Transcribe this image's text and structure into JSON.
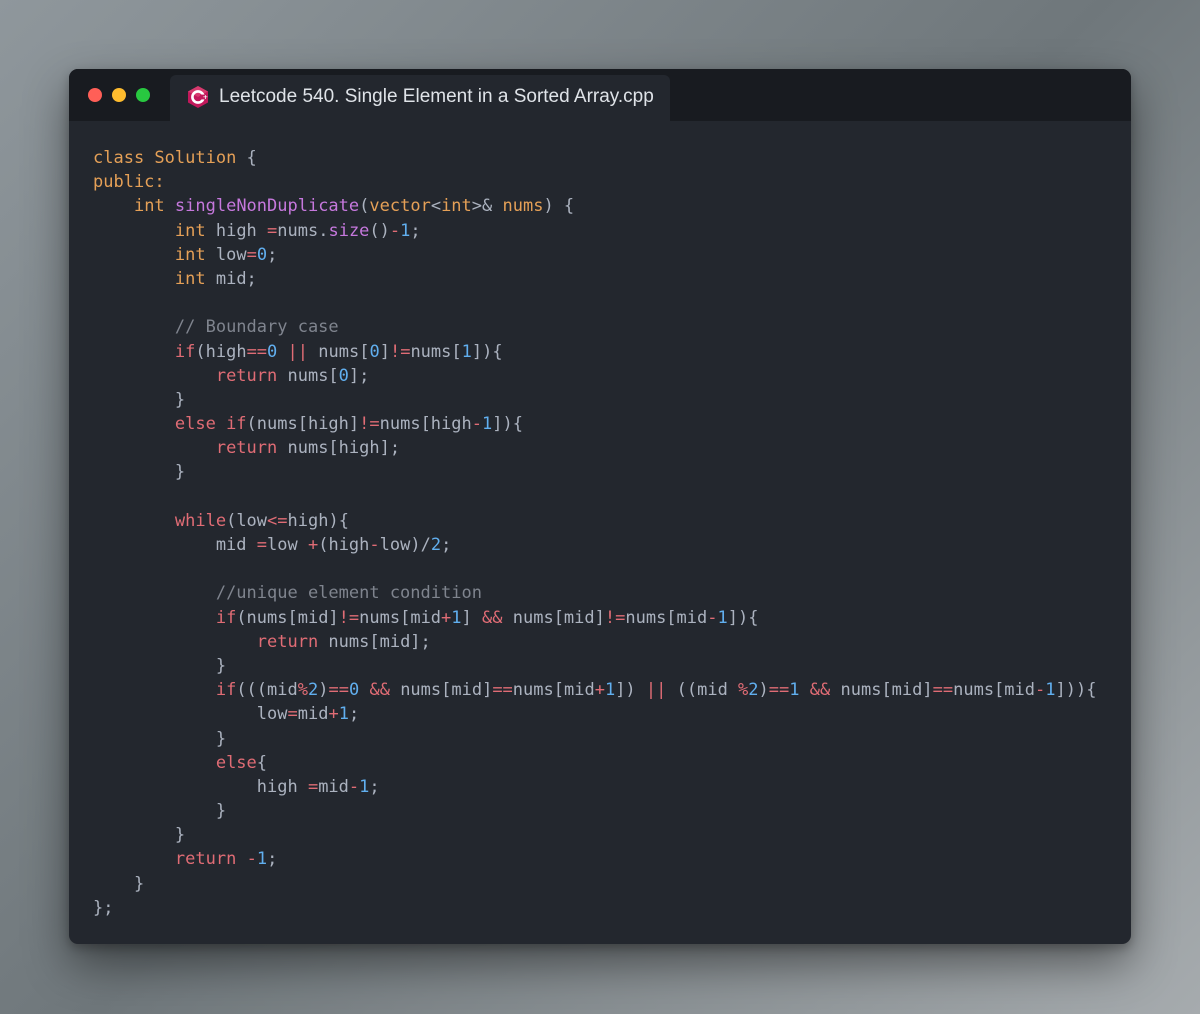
{
  "window": {
    "tab_title": "Leetcode 540. Single Element in a Sorted Array.cpp",
    "icon": "cpp-file-icon"
  },
  "colors": {
    "background": "#7d8589",
    "editor_bg": "#23272e",
    "titlebar_bg": "#181b20",
    "keyword": "#e06c75",
    "type": "#e5a057",
    "function": "#c678dd",
    "number": "#61afef",
    "comment": "#7f848e",
    "text": "#abb2bf"
  },
  "code_lines": [
    [
      [
        "ty",
        "class "
      ],
      [
        "ty",
        "Solution"
      ],
      [
        "pl",
        " {"
      ]
    ],
    [
      [
        "ty",
        "public:"
      ]
    ],
    [
      [
        "pl",
        "    "
      ],
      [
        "ty",
        "int "
      ],
      [
        "fn",
        "singleNonDuplicate"
      ],
      [
        "pl",
        "("
      ],
      [
        "ty",
        "vector"
      ],
      [
        "pl",
        "<"
      ],
      [
        "ty",
        "int"
      ],
      [
        "pl",
        ">& "
      ],
      [
        "ty",
        "nums"
      ],
      [
        "pl",
        ") {"
      ]
    ],
    [
      [
        "pl",
        "        "
      ],
      [
        "ty",
        "int "
      ],
      [
        "pl",
        "high "
      ],
      [
        "op",
        "="
      ],
      [
        "pl",
        "nums."
      ],
      [
        "fn",
        "size"
      ],
      [
        "pl",
        "()"
      ],
      [
        "op",
        "-"
      ],
      [
        "num",
        "1"
      ],
      [
        "pl",
        ";"
      ]
    ],
    [
      [
        "pl",
        "        "
      ],
      [
        "ty",
        "int "
      ],
      [
        "pl",
        "low"
      ],
      [
        "op",
        "="
      ],
      [
        "num",
        "0"
      ],
      [
        "pl",
        ";"
      ]
    ],
    [
      [
        "pl",
        "        "
      ],
      [
        "ty",
        "int "
      ],
      [
        "pl",
        "mid;"
      ]
    ],
    [
      [
        "pl",
        ""
      ]
    ],
    [
      [
        "pl",
        "        "
      ],
      [
        "cm",
        "// Boundary case"
      ]
    ],
    [
      [
        "pl",
        "        "
      ],
      [
        "kw",
        "if"
      ],
      [
        "pl",
        "(high"
      ],
      [
        "op",
        "=="
      ],
      [
        "num",
        "0"
      ],
      [
        "pl",
        " "
      ],
      [
        "op",
        "||"
      ],
      [
        "pl",
        " nums["
      ],
      [
        "num",
        "0"
      ],
      [
        "pl",
        "]"
      ],
      [
        "op",
        "!="
      ],
      [
        "pl",
        "nums["
      ],
      [
        "num",
        "1"
      ],
      [
        "pl",
        "]){"
      ]
    ],
    [
      [
        "pl",
        "            "
      ],
      [
        "kw",
        "return"
      ],
      [
        "pl",
        " nums["
      ],
      [
        "num",
        "0"
      ],
      [
        "pl",
        "];"
      ]
    ],
    [
      [
        "pl",
        "        }"
      ]
    ],
    [
      [
        "pl",
        "        "
      ],
      [
        "kw",
        "else if"
      ],
      [
        "pl",
        "(nums[high]"
      ],
      [
        "op",
        "!="
      ],
      [
        "pl",
        "nums[high"
      ],
      [
        "op",
        "-"
      ],
      [
        "num",
        "1"
      ],
      [
        "pl",
        "]){"
      ]
    ],
    [
      [
        "pl",
        "            "
      ],
      [
        "kw",
        "return"
      ],
      [
        "pl",
        " nums[high];"
      ]
    ],
    [
      [
        "pl",
        "        }"
      ]
    ],
    [
      [
        "pl",
        ""
      ]
    ],
    [
      [
        "pl",
        "        "
      ],
      [
        "kw",
        "while"
      ],
      [
        "pl",
        "(low"
      ],
      [
        "op",
        "<="
      ],
      [
        "pl",
        "high){"
      ]
    ],
    [
      [
        "pl",
        "            mid "
      ],
      [
        "op",
        "="
      ],
      [
        "pl",
        "low "
      ],
      [
        "op",
        "+"
      ],
      [
        "pl",
        "(high"
      ],
      [
        "op",
        "-"
      ],
      [
        "pl",
        "low)/"
      ],
      [
        "num",
        "2"
      ],
      [
        "pl",
        ";"
      ]
    ],
    [
      [
        "pl",
        ""
      ]
    ],
    [
      [
        "pl",
        "            "
      ],
      [
        "cm",
        "//unique element condition"
      ]
    ],
    [
      [
        "pl",
        "            "
      ],
      [
        "kw",
        "if"
      ],
      [
        "pl",
        "(nums[mid]"
      ],
      [
        "op",
        "!="
      ],
      [
        "pl",
        "nums[mid"
      ],
      [
        "op",
        "+"
      ],
      [
        "num",
        "1"
      ],
      [
        "pl",
        "] "
      ],
      [
        "op",
        "&&"
      ],
      [
        "pl",
        " nums[mid]"
      ],
      [
        "op",
        "!="
      ],
      [
        "pl",
        "nums[mid"
      ],
      [
        "op",
        "-"
      ],
      [
        "num",
        "1"
      ],
      [
        "pl",
        "]){"
      ]
    ],
    [
      [
        "pl",
        "                "
      ],
      [
        "kw",
        "return"
      ],
      [
        "pl",
        " nums[mid];"
      ]
    ],
    [
      [
        "pl",
        "            }"
      ]
    ],
    [
      [
        "pl",
        "            "
      ],
      [
        "kw",
        "if"
      ],
      [
        "pl",
        "(((mid"
      ],
      [
        "op",
        "%"
      ],
      [
        "num",
        "2"
      ],
      [
        "pl",
        ")"
      ],
      [
        "op",
        "=="
      ],
      [
        "num",
        "0"
      ],
      [
        "pl",
        " "
      ],
      [
        "op",
        "&&"
      ],
      [
        "pl",
        " nums[mid]"
      ],
      [
        "op",
        "=="
      ],
      [
        "pl",
        "nums[mid"
      ],
      [
        "op",
        "+"
      ],
      [
        "num",
        "1"
      ],
      [
        "pl",
        "]) "
      ],
      [
        "op",
        "||"
      ],
      [
        "pl",
        " ((mid "
      ],
      [
        "op",
        "%"
      ],
      [
        "num",
        "2"
      ],
      [
        "pl",
        ")"
      ],
      [
        "op",
        "=="
      ],
      [
        "num",
        "1"
      ],
      [
        "pl",
        " "
      ],
      [
        "op",
        "&&"
      ],
      [
        "pl",
        " nums[mid]"
      ],
      [
        "op",
        "=="
      ],
      [
        "pl",
        "nums[mid"
      ],
      [
        "op",
        "-"
      ],
      [
        "num",
        "1"
      ],
      [
        "pl",
        "])){"
      ]
    ],
    [
      [
        "pl",
        "                low"
      ],
      [
        "op",
        "="
      ],
      [
        "pl",
        "mid"
      ],
      [
        "op",
        "+"
      ],
      [
        "num",
        "1"
      ],
      [
        "pl",
        ";"
      ]
    ],
    [
      [
        "pl",
        "            }"
      ]
    ],
    [
      [
        "pl",
        "            "
      ],
      [
        "kw",
        "else"
      ],
      [
        "pl",
        "{"
      ]
    ],
    [
      [
        "pl",
        "                high "
      ],
      [
        "op",
        "="
      ],
      [
        "pl",
        "mid"
      ],
      [
        "op",
        "-"
      ],
      [
        "num",
        "1"
      ],
      [
        "pl",
        ";"
      ]
    ],
    [
      [
        "pl",
        "            }"
      ]
    ],
    [
      [
        "pl",
        "        }"
      ]
    ],
    [
      [
        "pl",
        "        "
      ],
      [
        "kw",
        "return"
      ],
      [
        "pl",
        " "
      ],
      [
        "op",
        "-"
      ],
      [
        "num",
        "1"
      ],
      [
        "pl",
        ";"
      ]
    ],
    [
      [
        "pl",
        "    }"
      ]
    ],
    [
      [
        "pl",
        "};"
      ]
    ]
  ]
}
